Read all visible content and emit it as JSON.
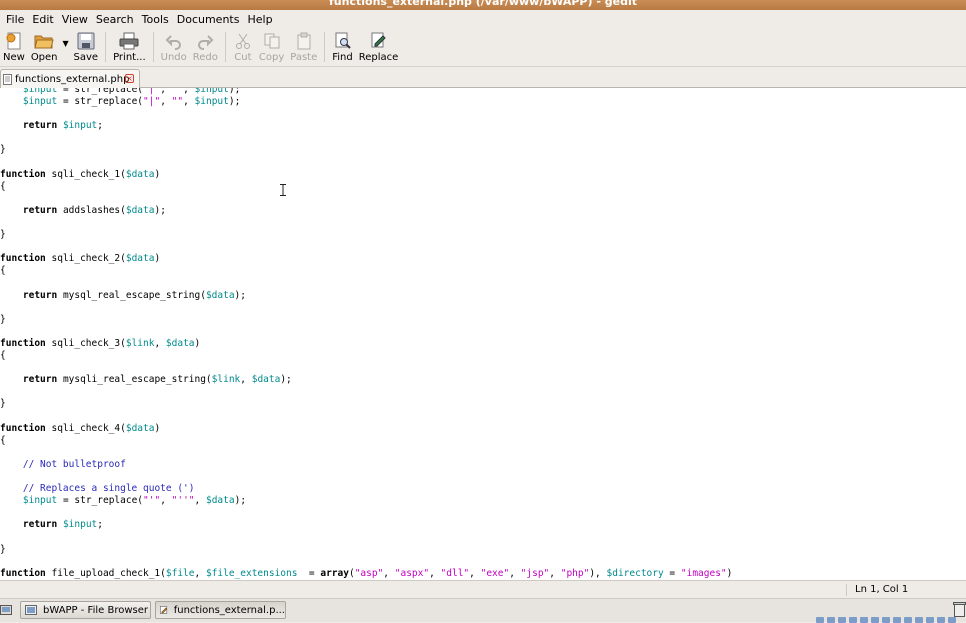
{
  "window": {
    "title": "functions_external.php (/var/www/bWAPP) - gedit"
  },
  "menu": [
    "File",
    "Edit",
    "View",
    "Search",
    "Tools",
    "Documents",
    "Help"
  ],
  "toolbar": {
    "new": "New",
    "open": "Open",
    "save": "Save",
    "print": "Print...",
    "undo": "Undo",
    "redo": "Redo",
    "cut": "Cut",
    "copy": "Copy",
    "paste": "Paste",
    "find": "Find",
    "replace": "Replace"
  },
  "tab": {
    "label": "functions_external.php",
    "close": "×"
  },
  "editor": {
    "lines": [
      "    $input = str_replace(\"|\", \"\", $input);",
      "    $input = str_replace(\"|\", \"\", $input);",
      "",
      "    return $input;",
      "",
      "}",
      "",
      "function sqli_check_1($data)",
      "{",
      "",
      "    return addslashes($data);",
      "",
      "}",
      "",
      "function sqli_check_2($data)",
      "{",
      "",
      "    return mysql_real_escape_string($data);",
      "",
      "}",
      "",
      "function sqli_check_3($link, $data)",
      "{",
      "",
      "    return mysqli_real_escape_string($link, $data);",
      "",
      "}",
      "",
      "function sqli_check_4($data)",
      "{",
      "",
      "    // Not bulletproof",
      "",
      "    // Replaces a single quote (')",
      "    $input = str_replace(\"'\", \"''\", $data);",
      "",
      "    return $input;",
      "",
      "}",
      "",
      "function file_upload_check_1($file, $file_extensions  = array(\"asp\", \"aspx\", \"dll\", \"exe\", \"jsp\", \"php\"), $directory = \"images\")"
    ]
  },
  "status": {
    "position": "Ln 1, Col 1"
  },
  "taskbar": {
    "items": [
      {
        "label": "bWAPP - File Browser"
      },
      {
        "label": "functions_external.p..."
      }
    ]
  },
  "colors": {
    "titlebar": "#c08549",
    "keyword": "#000000",
    "variable": "#008a8c",
    "string": "#c000c0",
    "comment": "#2a2ab8"
  }
}
